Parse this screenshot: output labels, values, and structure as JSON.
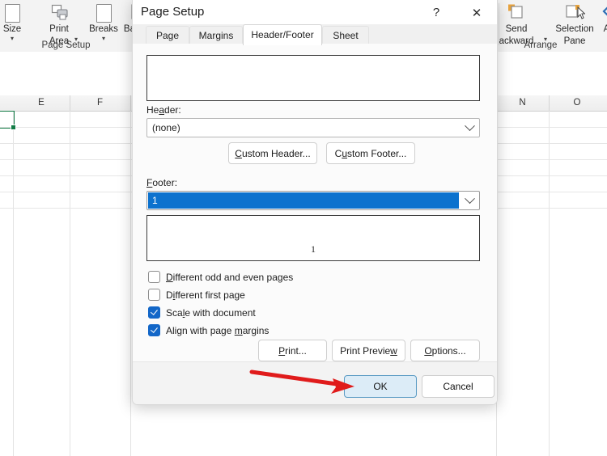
{
  "app": {
    "ribbon": {
      "groups": [
        {
          "label": "Page Setup"
        },
        {
          "label": "Arrange"
        }
      ],
      "buttons": [
        {
          "label_line1": "Size",
          "label_line2": "",
          "caret": true,
          "icon": "page-size-icon"
        },
        {
          "label_line1": "Print",
          "label_line2": "Area",
          "caret": true,
          "icon": "print-area-icon"
        },
        {
          "label_line1": "Breaks",
          "label_line2": "",
          "caret": true,
          "icon": "page-breaks-icon"
        },
        {
          "label_line1": "Backgro",
          "label_line2": "",
          "caret": false,
          "icon": "background-image-icon"
        },
        {
          "label_line1": "Send",
          "label_line2": "ackward",
          "caret": true,
          "icon": "send-backward-icon"
        },
        {
          "label_line1": "Selection",
          "label_line2": "Pane",
          "caret": false,
          "icon": "selection-pane-icon"
        },
        {
          "label_line1": "Ali",
          "label_line2": "",
          "caret": true,
          "icon": "align-objects-icon"
        }
      ]
    },
    "grid": {
      "columns_left": [
        "E",
        "F"
      ],
      "columns_right": [
        "N",
        "O"
      ]
    }
  },
  "dialog": {
    "title": "Page Setup",
    "help_glyph": "?",
    "close_glyph": "✕",
    "tabs": [
      {
        "label": "Page",
        "active": false
      },
      {
        "label": "Margins",
        "active": false
      },
      {
        "label": "Header/Footer",
        "active": true
      },
      {
        "label": "Sheet",
        "active": false
      }
    ],
    "header_preview": {
      "text": ""
    },
    "header": {
      "label_pre": "He",
      "label_acc": "a",
      "label_post": "der:",
      "value": "(none)"
    },
    "custom_header_button": {
      "acc": "C",
      "rest": "ustom Header..."
    },
    "custom_footer_button": {
      "pre": "C",
      "acc": "u",
      "rest": "stom Footer..."
    },
    "footer": {
      "label_acc": "F",
      "label_post": "ooter:",
      "value": "1",
      "selected": true
    },
    "footer_preview": {
      "text": "1"
    },
    "checkboxes": [
      {
        "acc": "D",
        "rest": "ifferent odd and even pages",
        "checked": false,
        "name": "different-odd-even-pages"
      },
      {
        "pre": "D",
        "acc": "i",
        "rest": "fferent first page",
        "checked": false,
        "name": "different-first-page"
      },
      {
        "pre": "Sca",
        "acc": "l",
        "rest": "e with document",
        "checked": true,
        "name": "scale-with-document"
      },
      {
        "pre": "Align with page ",
        "acc": "m",
        "rest": "argins",
        "checked": true,
        "name": "align-with-page-margins"
      }
    ],
    "buttons": {
      "print": {
        "acc": "P",
        "rest": "rint..."
      },
      "print_preview": {
        "pre": "Print Previe",
        "acc": "w",
        "rest": ""
      },
      "options": {
        "acc": "O",
        "rest": "ptions..."
      },
      "ok": "OK",
      "cancel": "Cancel"
    }
  },
  "annotation": {
    "arrow_color": "#e01b1b",
    "points_to": "ok-button"
  }
}
